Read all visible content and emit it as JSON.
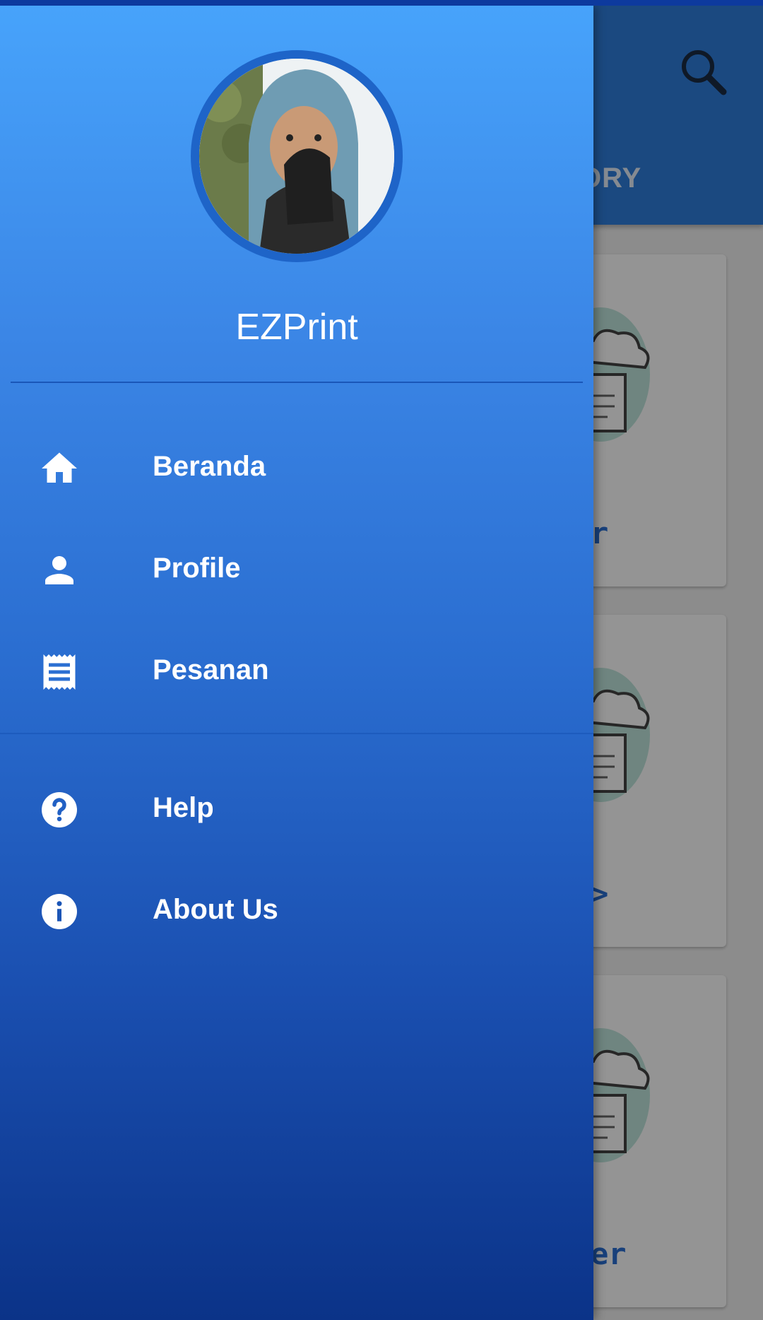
{
  "drawer": {
    "app_name": "EZPrint",
    "avatar": "profile-photo",
    "primary_items": [
      {
        "label": "Beranda",
        "icon": "home-icon"
      },
      {
        "label": "Profile",
        "icon": "person-icon"
      },
      {
        "label": "Pesanan",
        "icon": "receipt-icon"
      }
    ],
    "secondary_items": [
      {
        "label": "Help",
        "icon": "help-icon"
      },
      {
        "label": "About Us",
        "icon": "info-icon"
      }
    ]
  },
  "background": {
    "tab_label_partial": "ORY",
    "card_captions": [
      "r",
      ">",
      "er"
    ],
    "search_icon": "search-icon"
  },
  "colors": {
    "drawer_top": "#47a3fb",
    "drawer_bottom": "#0b3388",
    "toolbar": "#2f7fdc",
    "avatar_ring": "#1e64c8"
  }
}
